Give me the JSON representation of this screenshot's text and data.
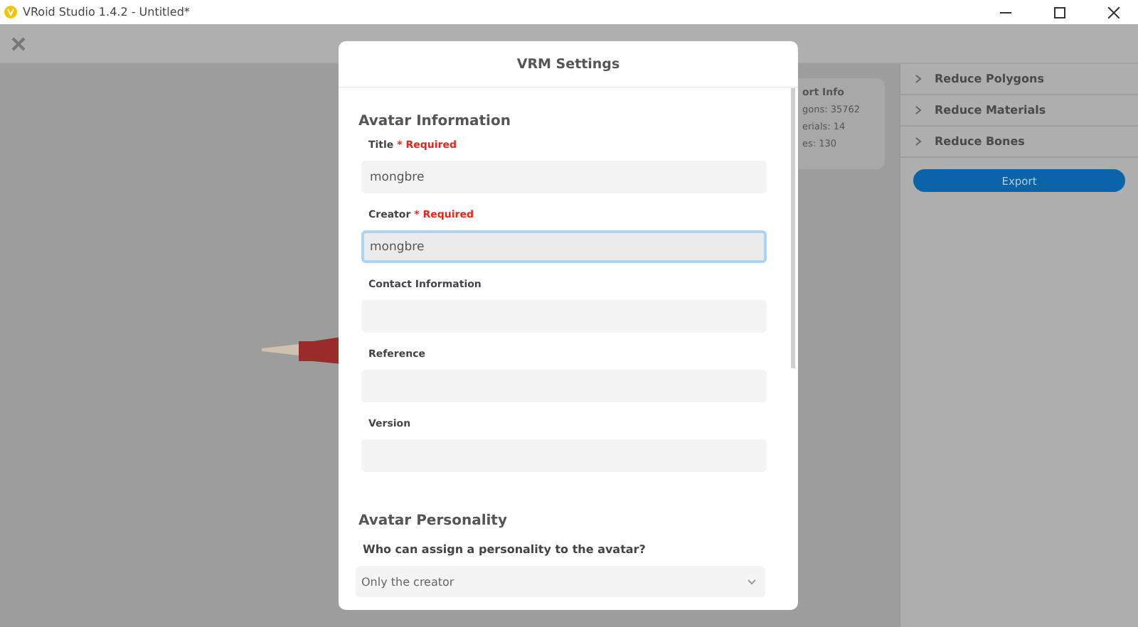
{
  "window": {
    "title": "VRoid Studio 1.4.2 - Untitled*"
  },
  "export_info": {
    "title": "ort Info",
    "lines": [
      "gons: 35762",
      "erials: 14",
      "es: 130"
    ]
  },
  "panel_sections": [
    {
      "label": "Reduce Polygons",
      "expanded": false
    },
    {
      "label": "Reduce Materials",
      "expanded": false
    },
    {
      "label": "Reduce Bones",
      "expanded": false
    }
  ],
  "export_button": "Export",
  "dialog": {
    "title": "VRM Settings",
    "sections": [
      {
        "heading": "Avatar Information",
        "fields": [
          {
            "kind": "text",
            "label": "Title",
            "required_note": "* Required",
            "value": "mongbre",
            "focused": false
          },
          {
            "kind": "text",
            "label": "Creator",
            "required_note": "* Required",
            "value": "mongbre",
            "focused": true
          },
          {
            "kind": "text",
            "label": "Contact Information",
            "focused": false
          },
          {
            "kind": "text",
            "label": "Reference",
            "focused": false
          },
          {
            "kind": "text",
            "label": "Version",
            "focused": false
          }
        ]
      },
      {
        "heading": "Avatar Personality",
        "fields": [
          {
            "kind": "select",
            "label": "Who can assign a personality to the avatar?",
            "value": "Only the creator",
            "focused": false
          }
        ]
      }
    ]
  }
}
